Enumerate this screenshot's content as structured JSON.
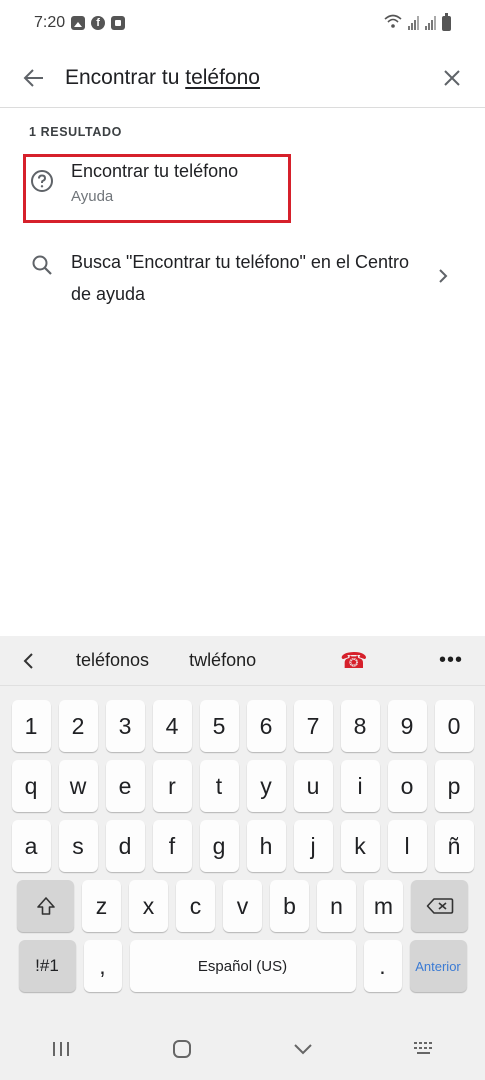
{
  "status_bar": {
    "time": "7:20"
  },
  "search": {
    "query_prefix": "Encontrar tu ",
    "query_underlined": "teléfono"
  },
  "results": {
    "heading": "1 RESULTADO",
    "items": [
      {
        "title": "Encontrar tu teléfono",
        "subtitle": "Ayuda",
        "icon": "help-circle-icon"
      }
    ],
    "search_suggestion": {
      "text": "Busca \"Encontrar tu teléfono\" en el Centro de ayuda",
      "icon": "search-icon"
    }
  },
  "keyboard": {
    "suggestions": [
      "teléfonos",
      "twléfono"
    ],
    "suggestion_emoji": "☎",
    "more_label": "•••",
    "rows": [
      [
        "1",
        "2",
        "3",
        "4",
        "5",
        "6",
        "7",
        "8",
        "9",
        "0"
      ],
      [
        "q",
        "w",
        "e",
        "r",
        "t",
        "y",
        "u",
        "i",
        "o",
        "p"
      ],
      [
        "a",
        "s",
        "d",
        "f",
        "g",
        "h",
        "j",
        "k",
        "l",
        "ñ"
      ],
      [
        "z",
        "x",
        "c",
        "v",
        "b",
        "n",
        "m"
      ]
    ],
    "symbols_label": "!#1",
    "comma_label": ",",
    "space_label": "Español (US)",
    "period_label": ".",
    "action_label": "Anterior"
  },
  "colors": {
    "highlight": "#d6202b",
    "action_text": "#3b7bd4"
  }
}
